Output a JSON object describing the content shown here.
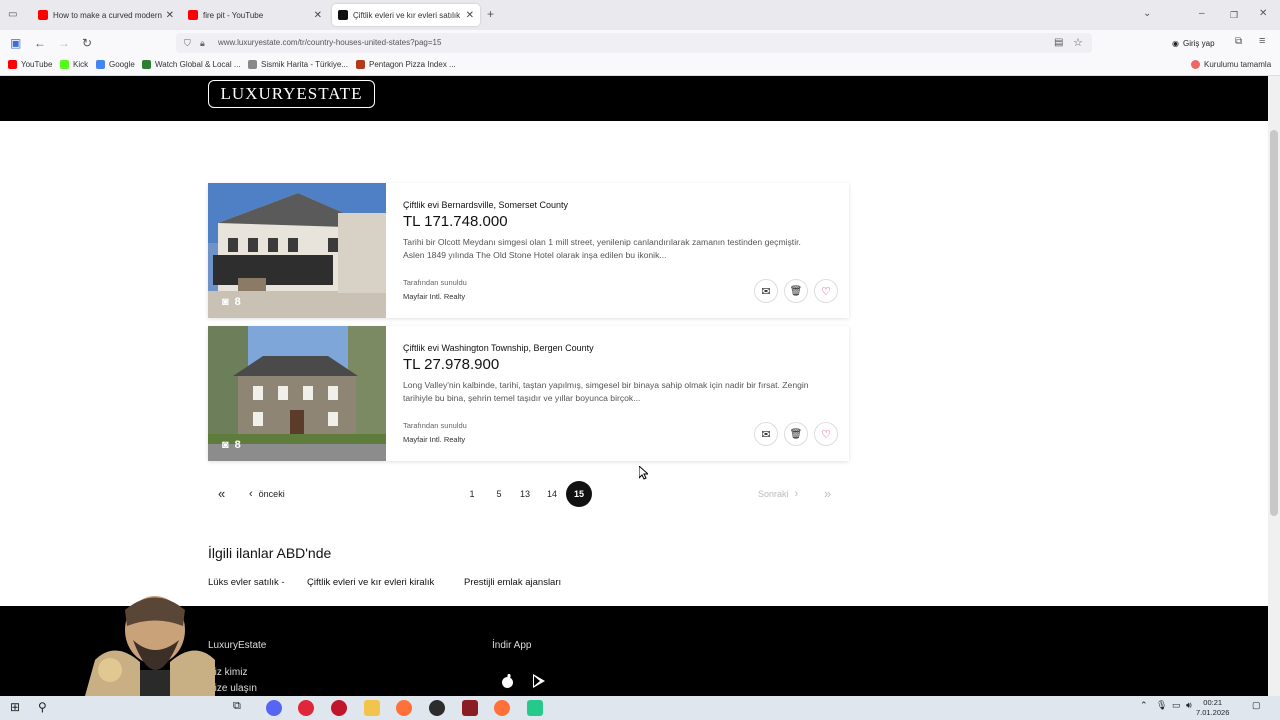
{
  "browser": {
    "tabs": [
      {
        "title": "How to make a curved modern",
        "close": "✕",
        "color": "#ff0000"
      },
      {
        "title": "fire pit - YouTube",
        "close": "✕",
        "color": "#ff0000"
      },
      {
        "title": "Çiftlik evleri ve kır evleri satılık Ai",
        "close": "✕",
        "color": "#111111"
      }
    ],
    "new_tab": "+",
    "url": "www.luxuryestate.com/tr/country-houses-united-states?pag=15",
    "signin": "Giriş yap",
    "bookmarks": [
      {
        "label": "YouTube",
        "color": "#ff0000"
      },
      {
        "label": "Kick",
        "color": "#53fc18"
      },
      {
        "label": "Google",
        "color": "#4285f4"
      },
      {
        "label": "Watch Global & Local ...",
        "color": "#2e7d32"
      },
      {
        "label": "Sismik Harita - Türkiye...",
        "color": "#888888"
      },
      {
        "label": "Pentagon Pizza Index ...",
        "color": "#b23a1a"
      }
    ],
    "bookmark_right": "Kurulumu tamamla"
  },
  "site": {
    "logo": "LUXURYESTATE"
  },
  "listings": [
    {
      "title": "Çiftlik evi Bernardsville, Somerset County",
      "price": "TL 171.748.000",
      "description": "Tarihi bir Olcott Meydanı simgesi olan 1 mill street, yenilenip canlandırılarak zamanın testinden geçmiştir. Aslen 1849 yılında The Old Stone Hotel olarak inşa edilen bu ikonik...",
      "photo_count": "8",
      "presented_by": "Tarafından sunuldu",
      "agency": "Mayfair Intl. Realty"
    },
    {
      "title": "Çiftlik evi Washington Township, Bergen County",
      "price": "TL 27.978.900",
      "description": "Long Valley'nin kalbinde, tarihi, taştan yapılmış, simgesel bir binaya sahip olmak için nadir bir fırsat. Zengin tarihiyle bu bina, şehrin temel taşıdır ve yıllar boyunca birçok...",
      "photo_count": "8",
      "presented_by": "Tarafından sunuldu",
      "agency": "Mayfair Intl. Realty"
    }
  ],
  "pagination": {
    "first": "«",
    "prev": "önceki",
    "pages": [
      "1",
      "5",
      "13",
      "14"
    ],
    "current": "15",
    "next": "Sonraki",
    "last": "»"
  },
  "related": {
    "title": "İlgili ilanlar ABD'nde",
    "links": [
      "Lüks evler satılık -",
      "Çiftlik evleri ve kır evleri kiralık",
      "Prestijli emlak ajansları"
    ]
  },
  "footer": {
    "brand": "LuxuryEstate",
    "about": "Biz kimiz",
    "contact": "Bize ulaşın",
    "app": "İndir App"
  },
  "taskbar": {
    "time": "00:21",
    "date": "7.01.2026"
  }
}
